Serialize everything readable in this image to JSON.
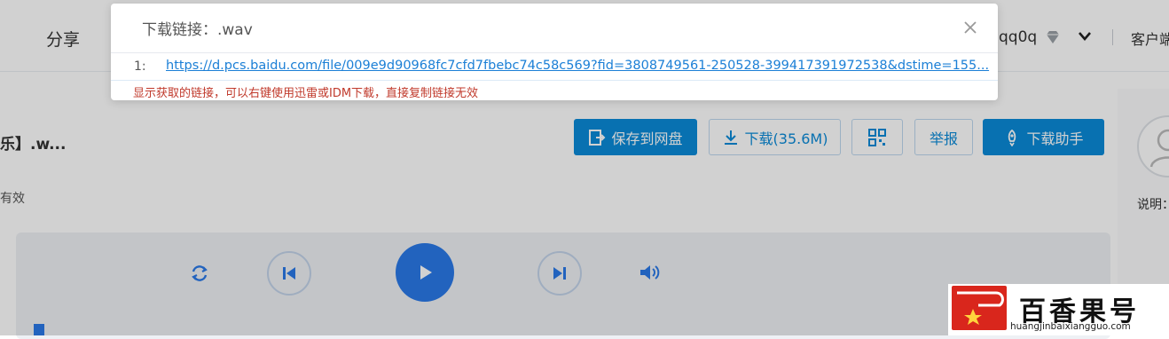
{
  "header": {
    "share_label": "分享",
    "username": "qq0q",
    "client_label": "客户端"
  },
  "file": {
    "title": "乐】.w...",
    "validity": "有效"
  },
  "toolbar": {
    "save_label": "保存到网盘",
    "download_label": "下载(35.6M)",
    "report_label": "举报",
    "helper_label": "下载助手"
  },
  "sidebar": {
    "explain_label": "说明："
  },
  "dialog": {
    "title": "下载链接：.wav",
    "link_index": "1:",
    "link_url": "https://d.pcs.baidu.com/file/009e9d90968fc7cfd7fbebc74c58c569?fid=3808749561-250528-399417391972538&dstime=155...",
    "note": "显示获取的链接，可以右键使用迅雷或IDM下载，直接复制链接无效"
  },
  "watermark": {
    "name": "百香果号",
    "url": "huangjinbaixiangguo.com"
  },
  "colors": {
    "accent": "#0a8ad8",
    "play": "#2a79e8",
    "note": "#c0392b",
    "link": "#1b7fd6"
  }
}
